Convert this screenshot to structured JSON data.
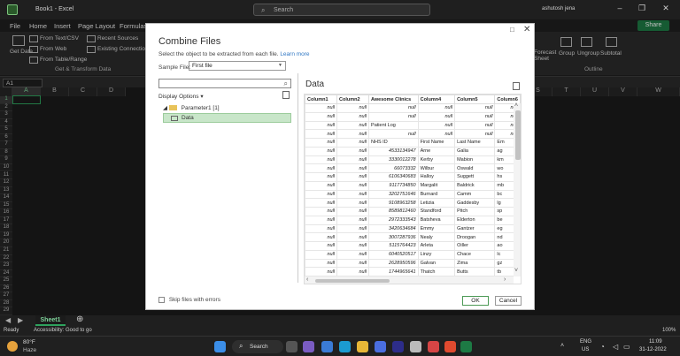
{
  "titlebar": {
    "title": "Book1 - Excel",
    "search_placeholder": "Search",
    "user": "ashutosh jena"
  },
  "menu": {
    "items": [
      "File",
      "Home",
      "Insert",
      "Page Layout",
      "Formulas"
    ],
    "share_label": "Share"
  },
  "ribbon": {
    "get_data": "Get Data",
    "from_text_csv": "From Text/CSV",
    "from_web": "From Web",
    "from_table_range": "From Table/Range",
    "recent_sources": "Recent Sources",
    "existing_connections": "Existing Connections",
    "group_label": "Get & Transform Data",
    "forecast_sheet": "Forecast Sheet",
    "group": "Group",
    "ungroup": "Ungroup",
    "subtotal": "Subtotal",
    "outline_label": "Outline"
  },
  "formula_bar": {
    "name_box": "A1"
  },
  "grid": {
    "columns_left": [
      "A",
      "B",
      "C",
      "D"
    ],
    "columns_right": [
      "S",
      "T",
      "U",
      "V",
      "W"
    ],
    "rows": [
      "1",
      "2",
      "3",
      "4",
      "5",
      "6",
      "7",
      "8",
      "9",
      "10",
      "11",
      "12",
      "13",
      "14",
      "15",
      "16",
      "17",
      "18",
      "19",
      "20",
      "21",
      "22",
      "23",
      "24",
      "25",
      "26",
      "27",
      "28",
      "29"
    ]
  },
  "sheet_tab": "Sheet1",
  "status": {
    "ready": "Ready",
    "accessibility": "Accessibility: Good to go",
    "zoom": "100%"
  },
  "taskbar": {
    "weather_temp": "80°F",
    "weather_desc": "Haze",
    "search": "Search",
    "lang1": "ENG",
    "lang2": "US",
    "time": "11:09",
    "date": "31-12-2022"
  },
  "dialog": {
    "title": "Combine Files",
    "subtitle": "Select the object to be extracted from each file.",
    "learn_more": "Learn more",
    "sample_file_label": "Sample File:",
    "sample_file_value": "First file",
    "display_options": "Display Options",
    "tree_folder": "Parameter1 [1]",
    "tree_item": "Data",
    "data_title": "Data",
    "skip_label": "Skip files with errors",
    "ok": "OK",
    "cancel": "Cancel",
    "table": {
      "headers": [
        "Column1",
        "Column2",
        "Awesome Clinics",
        "Column4",
        "Column5",
        "Column6"
      ],
      "rows": [
        [
          "null",
          "null",
          "null",
          "null",
          "null",
          "null"
        ],
        [
          "null",
          "null",
          "null",
          "null",
          "null",
          "null"
        ],
        [
          "null",
          "null",
          "Patient Log",
          "null",
          "null",
          "null"
        ],
        [
          "null",
          "null",
          "null",
          "null",
          "null",
          "null"
        ],
        [
          "null",
          "null",
          "NHS ID",
          "First Name",
          "Last Name",
          "Em"
        ],
        [
          "null",
          "null",
          "4533134947",
          "Arne",
          "Galia",
          "ag"
        ],
        [
          "null",
          "null",
          "3330012278",
          "Kerby",
          "Mabion",
          "km"
        ],
        [
          "null",
          "null",
          "66073332",
          "Wilbur",
          "Oswald",
          "wo"
        ],
        [
          "null",
          "null",
          "6106340683",
          "Halloy",
          "Suggett",
          "hs"
        ],
        [
          "null",
          "null",
          "9117734850",
          "Margalit",
          "Baldrick",
          "mb"
        ],
        [
          "null",
          "null",
          "3202751646",
          "Burnard",
          "Camm",
          "bc"
        ],
        [
          "null",
          "null",
          "9108963258",
          "Letizia",
          "Gaddesby",
          "lg"
        ],
        [
          "null",
          "null",
          "8589812460",
          "Standford",
          "Pitch",
          "sp"
        ],
        [
          "null",
          "null",
          "2972333543",
          "Batsheva",
          "Elderton",
          "be"
        ],
        [
          "null",
          "null",
          "3420634684",
          "Emmy",
          "Gantzer",
          "eg"
        ],
        [
          "null",
          "null",
          "3007287936",
          "Nealy",
          "Droogan",
          "nd"
        ],
        [
          "null",
          "null",
          "5115764423",
          "Arleta",
          "Oiller",
          "ao"
        ],
        [
          "null",
          "null",
          "6040520517",
          "Linzy",
          "Chace",
          "lc"
        ],
        [
          "null",
          "null",
          "2628950596",
          "Galvan",
          "Zima",
          "gz"
        ],
        [
          "null",
          "null",
          "1744965641",
          "Thatch",
          "Butts",
          "tb"
        ]
      ]
    }
  },
  "colors": {
    "excel_green": "#2ea25d",
    "selection": "#c8e6c9",
    "link": "#2f77c4"
  }
}
